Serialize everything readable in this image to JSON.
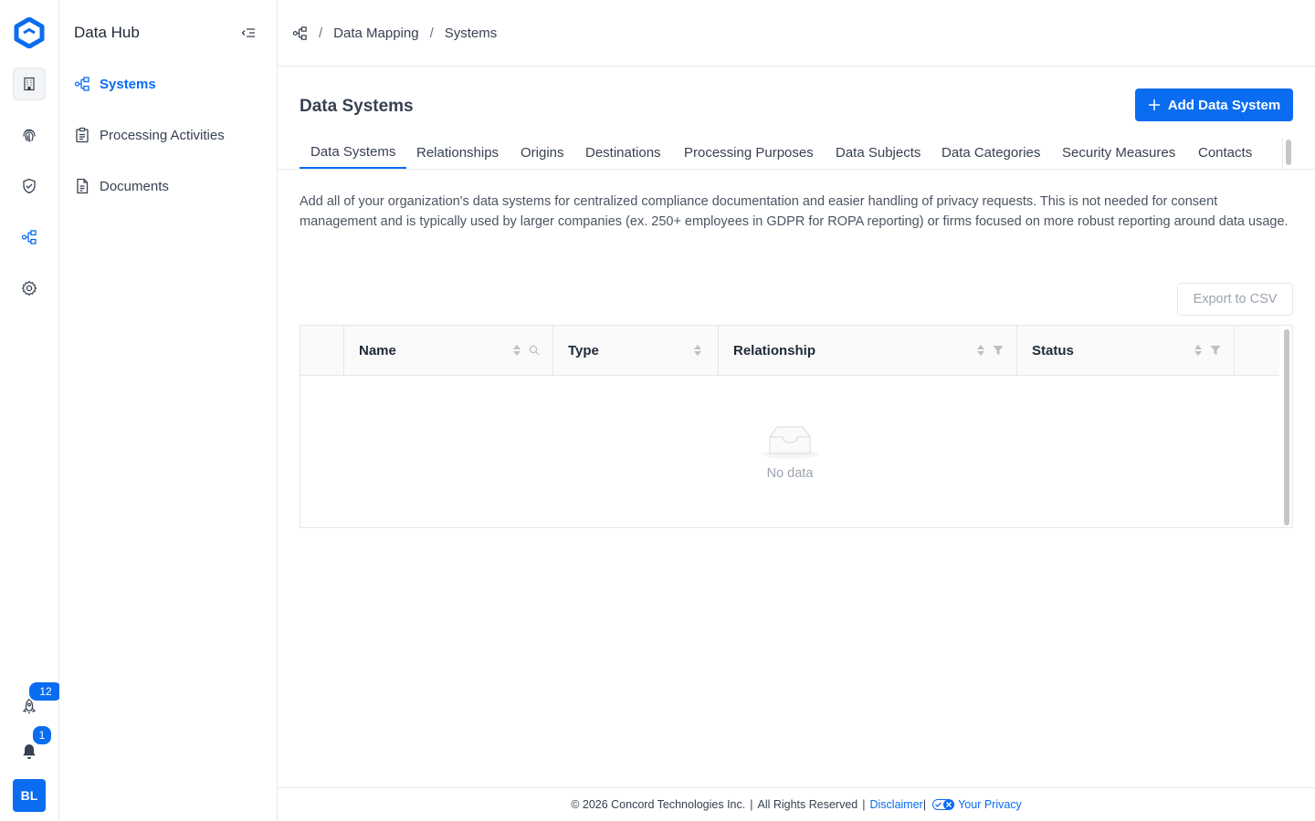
{
  "app": {
    "rail": {
      "icons": [
        "concord-logo-icon",
        "building-icon",
        "fingerprint-icon",
        "shield-check-icon",
        "data-map-icon",
        "gear-icon",
        "rocket-icon",
        "bell-icon"
      ],
      "rocket_badge": "12",
      "bell_badge": "1",
      "avatar_initials": "BL"
    },
    "sidebar": {
      "title": "Data Hub",
      "items": [
        {
          "label": "Systems",
          "icon": "data-map-icon",
          "active": true
        },
        {
          "label": "Processing Activities",
          "icon": "clipboard-icon",
          "active": false
        },
        {
          "label": "Documents",
          "icon": "document-icon",
          "active": false
        }
      ]
    },
    "breadcrumb": {
      "icon": "data-map-icon",
      "items": [
        "Data Mapping",
        "Systems"
      ]
    },
    "page": {
      "title": "Data Systems",
      "add_button_label": "Add Data System",
      "tabs": [
        "Data Systems",
        "Relationships",
        "Origins",
        "Destinations",
        "Processing Purposes",
        "Data Subjects",
        "Data Categories",
        "Security Measures",
        "Contacts"
      ],
      "active_tab": "Data Systems",
      "description": "Add all of your organization's data systems for centralized compliance documentation and easier handling of privacy requests. This is not needed for consent management and is typically used by larger companies (ex. 250+ employees in GDPR for ROPA reporting) or firms focused on more robust reporting around data usage.",
      "export_button_label": "Export to CSV"
    },
    "table": {
      "columns": [
        "Name",
        "Type",
        "Relationship",
        "Status"
      ],
      "empty_text": "No data"
    },
    "footer": {
      "copyright": "© 2026 Concord Technologies Inc.",
      "rights": "All Rights Reserved",
      "disclaimer": "Disclaimer",
      "privacy": "Your Privacy"
    },
    "colors": {
      "accent": "#0a6cf1",
      "border": "#e5e7eb",
      "muted": "#9ca3af"
    }
  }
}
